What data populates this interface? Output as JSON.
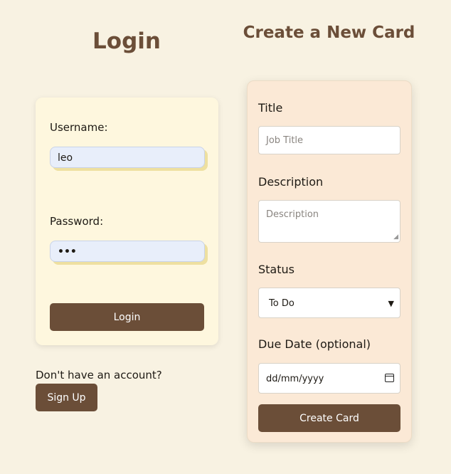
{
  "login": {
    "title": "Login",
    "username_label": "Username:",
    "username_value": "leo",
    "password_label": "Password:",
    "password_value": "•••",
    "button_label": "Login"
  },
  "signup": {
    "prompt": "Don't have an account?",
    "button_label": "Sign Up"
  },
  "create_card": {
    "title": "Create a New Card",
    "title_label": "Title",
    "title_placeholder": "Job Title",
    "description_label": "Description",
    "description_placeholder": "Description",
    "status_label": "Status",
    "status_selected": "To Do",
    "due_date_label": "Due Date (optional)",
    "due_date_placeholder": "dd/mm/yyyy",
    "button_label": "Create Card"
  },
  "colors": {
    "background": "#f8f2e2",
    "accent": "#6b4e38",
    "login_panel": "#fef7de",
    "card_panel": "#fbe9d6",
    "input_fill": "#e8eefa"
  },
  "icons": {
    "status_dropdown": "chevron-down-icon",
    "due_date": "calendar-icon"
  }
}
